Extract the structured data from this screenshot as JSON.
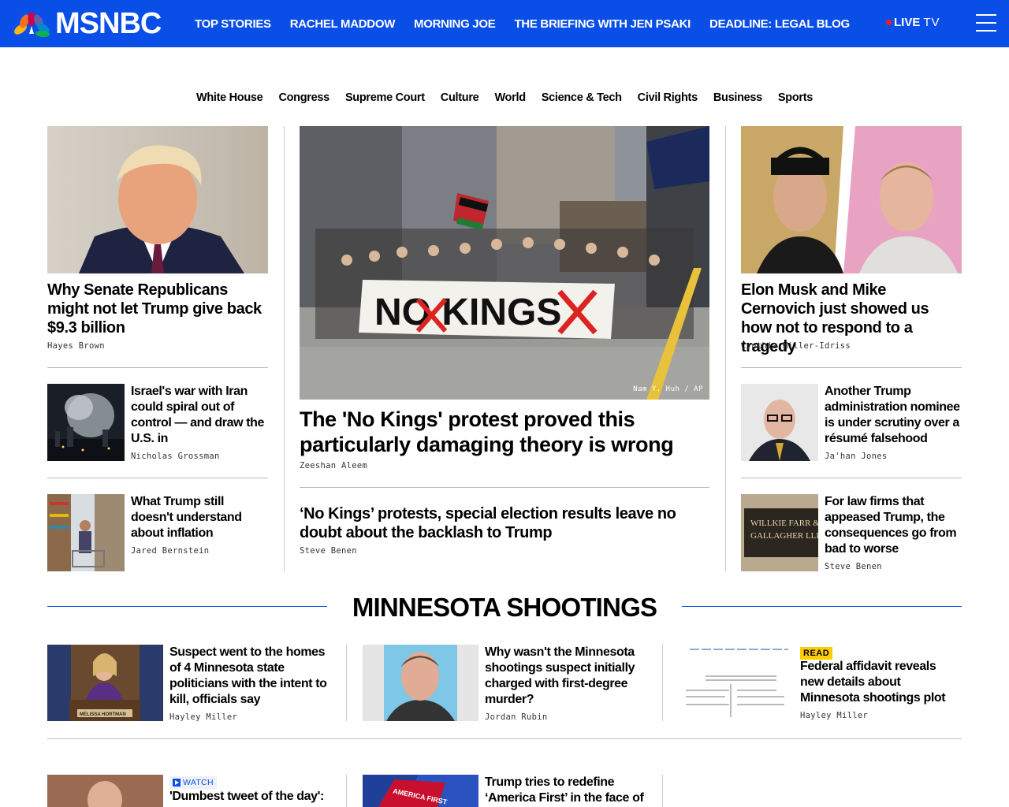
{
  "nav": {
    "logo_text": "MSNBC",
    "links": [
      "TOP STORIES",
      "RACHEL MADDOW",
      "MORNING JOE",
      "THE BRIEFING WITH JEN PSAKI",
      "DEADLINE: LEGAL BLOG"
    ],
    "live_label": "LIVE",
    "live_tv": "TV"
  },
  "subnav": [
    "White House",
    "Congress",
    "Supreme Court",
    "Culture",
    "World",
    "Science & Tech",
    "Civil Rights",
    "Business",
    "Sports"
  ],
  "left_column": {
    "lead": {
      "headline": "Why Senate Republicans might not let Trump give back $9.3 billion",
      "byline": "Hayes Brown"
    },
    "items": [
      {
        "headline": "Israel's war with Iran could spiral out of control — and draw the U.S. in",
        "byline": "Nicholas Grossman"
      },
      {
        "headline": "What Trump still doesn't understand about inflation",
        "byline": "Jared Bernstein"
      }
    ]
  },
  "center_column": {
    "photo_credit": "Nam Y. Huh / AP",
    "lead": {
      "headline": "The 'No Kings' protest proved this particularly damaging theory is wrong",
      "byline": "Zeeshan Aleem"
    },
    "second": {
      "headline": "‘No Kings’ protests, special election results leave no doubt about the backlash to Trump",
      "byline": "Steve Benen"
    },
    "banner_text": "NO KINGS"
  },
  "right_column": {
    "lead": {
      "headline": "Elon Musk and Mike Cernovich just showed us how not to respond to a tragedy",
      "byline": "Cynthia Miller-Idriss"
    },
    "items": [
      {
        "headline": "Another Trump administration nominee is under scrutiny over a résumé falsehood",
        "byline": "Ja'han Jones"
      },
      {
        "headline": "For law firms that appeased Trump, the consequences go from bad to worse",
        "byline": "Steve Benen"
      }
    ],
    "sign_text": [
      "WILLKIE FARR &",
      "GALLAGHER LLP"
    ]
  },
  "minnesota": {
    "title": "MINNESOTA SHOOTINGS",
    "items": [
      {
        "headline": "Suspect went to the homes of 4 Minnesota state politicians with the intent to kill, officials say",
        "byline": "Hayley Miller",
        "podium_text": "MELISSA HORTMAN"
      },
      {
        "headline": "Why wasn't the Minnesota shootings suspect initially charged with first-degree murder?",
        "byline": "Jordan Rubin"
      },
      {
        "badge": "READ",
        "headline": "Federal affidavit reveals new details about Minnesota shootings plot",
        "byline": "Hayley Miller"
      }
    ]
  },
  "bottom_row": [
    {
      "badge": "WATCH",
      "headline": "'Dumbest tweet of the day':"
    },
    {
      "headline": "Trump tries to redefine ‘America First’ in the face of",
      "sign_text": "AMERICA FIRST"
    }
  ],
  "colors": {
    "brand_blue": "#0a4ee8",
    "live_red": "#ff1a1a",
    "read_badge": "#ffcc00"
  }
}
